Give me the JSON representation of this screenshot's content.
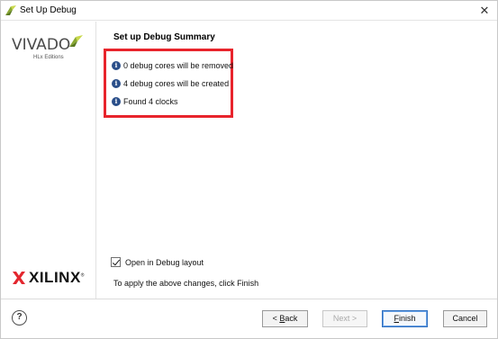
{
  "window": {
    "title": "Set Up Debug",
    "close_glyph": "✕",
    "title_icon": "vivado-leaf-icon"
  },
  "brand": {
    "vivado_word": "VIVADO",
    "vivado_subtitle": "HLx Editions",
    "xilinx_word": "XILINX",
    "xilinx_trademark": "®",
    "vivado_leaf_color": "#9ab933",
    "xilinx_x_color": "#e3262e"
  },
  "summary": {
    "title": "Set up Debug Summary",
    "items": [
      {
        "icon": "info-icon",
        "text": "0 debug cores will be removed"
      },
      {
        "icon": "info-icon",
        "text": "4 debug cores will be created"
      },
      {
        "icon": "info-icon",
        "text": "Found 4 clocks"
      }
    ],
    "highlight_color": "#e8242c"
  },
  "options": {
    "open_debug_layout_label": "Open in Debug layout",
    "open_debug_layout_checked": true,
    "apply_note": "To apply the above changes, click Finish"
  },
  "footer": {
    "help_glyph": "?",
    "back_label_prefix": "< ",
    "back_label_mnemonic": "B",
    "back_label_rest": "ack",
    "next_label": "Next >",
    "finish_mnemonic": "F",
    "finish_rest": "inish",
    "cancel_label": "Cancel"
  }
}
